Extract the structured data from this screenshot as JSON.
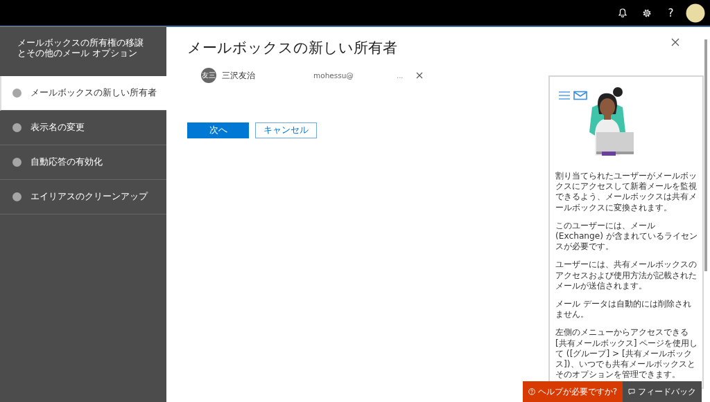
{
  "topbar": {
    "help_label": "?"
  },
  "nav": {
    "title_lines": [
      "メールボックスの所有権の移譲",
      "とその他のメール オプション"
    ],
    "steps": [
      {
        "label": "メールボックスの新しい所有者",
        "selected": true
      },
      {
        "label": "表示名の変更",
        "selected": false
      },
      {
        "label": "自動応答の有効化",
        "selected": false
      },
      {
        "label": "エイリアスのクリーンアップ",
        "selected": false
      }
    ]
  },
  "panel": {
    "title": "メールボックスの新しい所有者",
    "owner": {
      "initials": "友三",
      "name": "三沢友治",
      "email": "mohessu@",
      "more": "..."
    },
    "buttons": [
      {
        "label": "次へ",
        "kind": "primary"
      },
      {
        "label": "キャンセル",
        "kind": "secondary"
      }
    ]
  },
  "help_card": {
    "paragraphs": [
      "割り当てられたユーザーがメールボックスにアクセスして新着メールを監視できるよう、メールボックスは共有メールボックスに変換されます。",
      "このユーザーには、メール (Exchange) が含まれているライセンスが必要です。",
      "ユーザーには、共有メールボックスのアクセスおよび使用方法が記載されたメールが送信されます。",
      "メール データは自動的には削除されません。",
      "左側のメニューからアクセスできる [共有メールボックス] ページを使用して ([グループ] > [共有メールボックス])、いつでも共有メールボックスとそのオプションを管理できます。"
    ]
  },
  "footer_buttons": [
    {
      "label": "ヘルプが必要ですか?",
      "kind": "help"
    },
    {
      "label": "フィードバック",
      "kind": "feedback"
    }
  ]
}
